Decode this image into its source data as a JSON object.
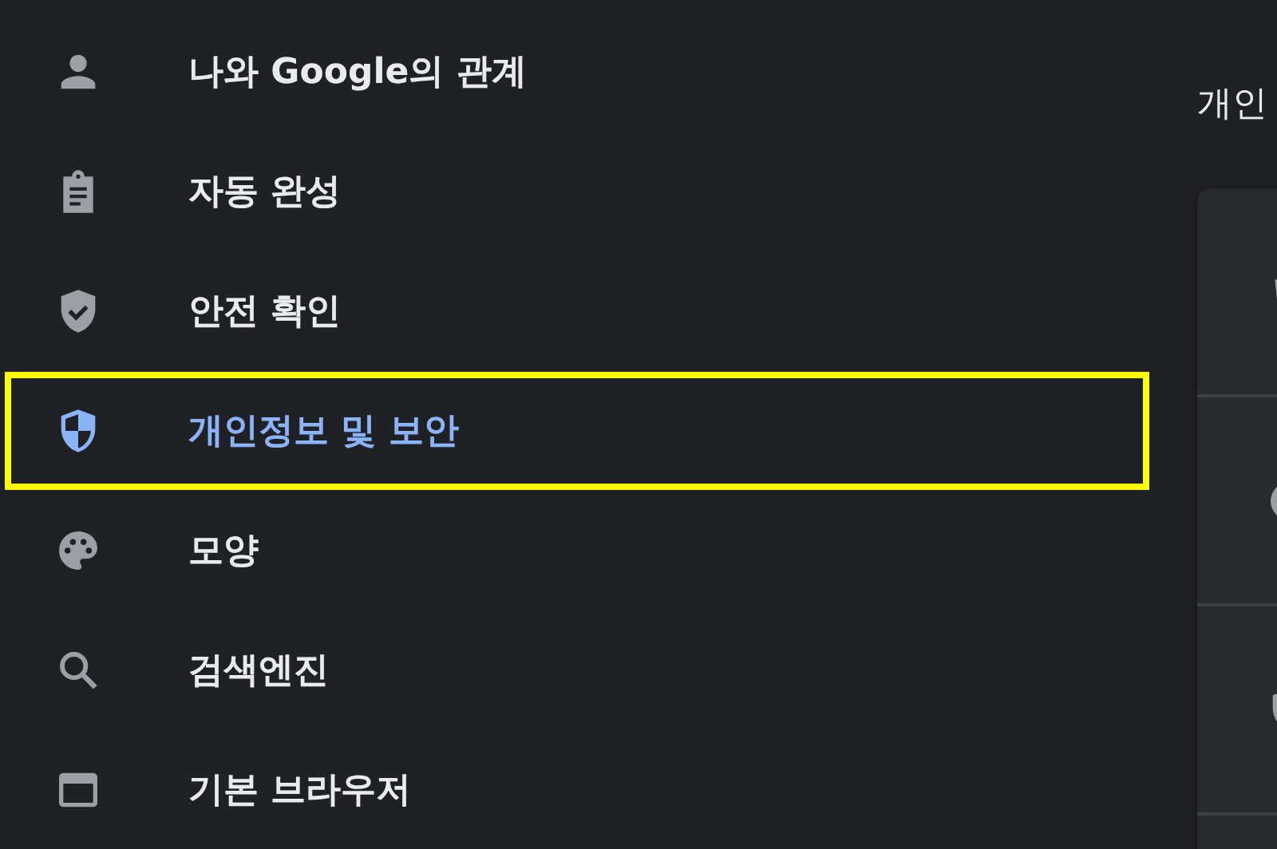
{
  "sidebar": {
    "items": [
      {
        "label": "나와 Google의 관계",
        "selected": false,
        "highlighted": false
      },
      {
        "label": "자동 완성",
        "selected": false,
        "highlighted": false
      },
      {
        "label": "안전 확인",
        "selected": false,
        "highlighted": false
      },
      {
        "label": "개인정보 및 보안",
        "selected": true,
        "highlighted": true
      },
      {
        "label": "모양",
        "selected": false,
        "highlighted": false
      },
      {
        "label": "검색엔진",
        "selected": false,
        "highlighted": false
      },
      {
        "label": "기본 브라우저",
        "selected": false,
        "highlighted": false
      }
    ]
  },
  "main": {
    "title": "개인"
  }
}
